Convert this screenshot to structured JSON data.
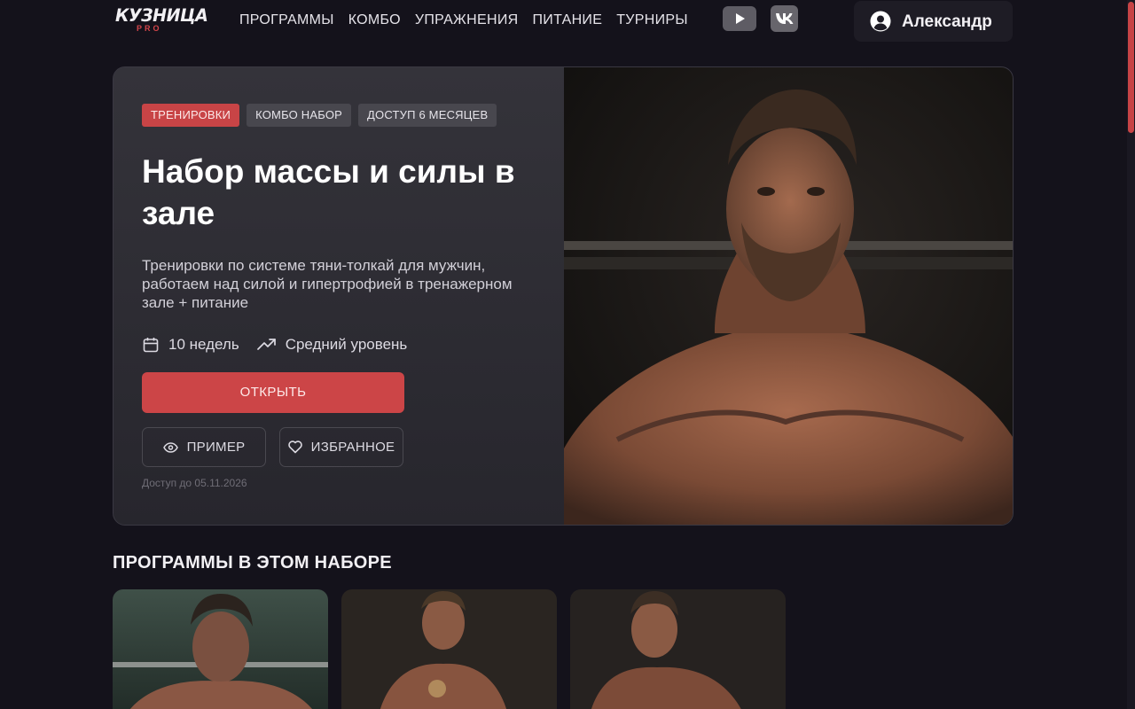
{
  "header": {
    "logo_text": "КУЗНИЦА",
    "logo_sub": "PRO",
    "nav": [
      "ПРОГРАММЫ",
      "КОМБО",
      "УПРАЖНЕНИЯ",
      "ПИТАНИЕ",
      "ТУРНИРЫ"
    ],
    "social_icons": [
      "youtube-icon",
      "vk-icon"
    ],
    "user_name": "Александр"
  },
  "hero": {
    "tags": [
      "ТРЕНИРОВКИ",
      "КОМБО НАБОР",
      "ДОСТУП 6 МЕСЯЦЕВ"
    ],
    "title": "Набор массы и силы в зале",
    "description": "Тренировки по системе тяни-толкай для мужчин, работаем над силой и гипертрофией в тренажерном зале + питание",
    "duration": "10 недель",
    "level": "Средний уровень",
    "open_label": "ОТКРЫТЬ",
    "example_label": "ПРИМЕР",
    "favorite_label": "ИЗБРАННОЕ",
    "access_text": "Доступ до 05.11.2026"
  },
  "section": {
    "title": "ПРОГРАММЫ В ЭТОМ НАБОРЕ"
  },
  "colors": {
    "accent": "#cc4547",
    "background": "#14121b",
    "card": "#2d2c33"
  }
}
